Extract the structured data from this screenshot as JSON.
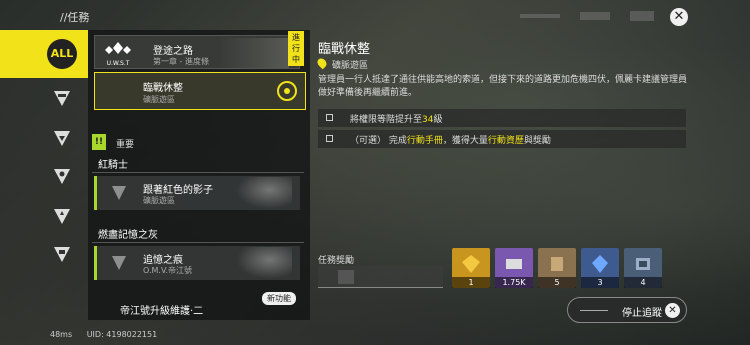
{
  "header": {
    "title": "//任務",
    "close_icon": "close-icon"
  },
  "rail": {
    "all_label": "ALL",
    "icons": [
      "category-icon-1",
      "category-icon-2",
      "category-icon-3",
      "category-icon-4",
      "category-icon-5"
    ]
  },
  "list": {
    "top_card": {
      "badge": "進行中",
      "logo_text": "U.W.S.T",
      "title": "登途之路",
      "subtitle": "第一章 - 進度條"
    },
    "active_card": {
      "title": "臨戰休整",
      "subtitle": "礦脈遊區"
    },
    "section_label": "重要",
    "groups": [
      {
        "title": "紅騎士",
        "item_title": "跟著紅色的影子",
        "item_subtitle": "礦脈遊區"
      },
      {
        "title": "燃盡記憶之灰",
        "item_title": "追憶之痕",
        "item_subtitle": "O.M.V.帝江號"
      },
      {
        "title": "帝江號升級維護·二",
        "new_tag": "新功能"
      }
    ]
  },
  "footer": {
    "ping": "48ms",
    "uid": "UID: 4198022151"
  },
  "detail": {
    "title": "臨戰休整",
    "location": "礦脈遊區",
    "description": "管理員一行人抵達了通往供能高地的索道，但接下來的道路更加危機四伏，佩麗卡建議管理員做好準備後再繼續前進。",
    "requirements": [
      {
        "prefix": "將權限等階提升至",
        "highlight": "34",
        "suffix": "級"
      },
      {
        "prefix": "（可選） 完成",
        "highlight": "行動手冊",
        "suffix": "，獲得大量",
        "highlight2": "行動資歷",
        "suffix2": "與獎勵"
      }
    ]
  },
  "rewards": {
    "label": "任務獎勵",
    "items": [
      {
        "amount": "1",
        "color": "#c8961e",
        "icon": "gold-crystal-icon"
      },
      {
        "amount": "1.75K",
        "color": "#7a58b0",
        "icon": "ticket-icon"
      },
      {
        "amount": "5",
        "color": "#8a7250",
        "icon": "material-icon"
      },
      {
        "amount": "3",
        "color": "#3e5a8e",
        "icon": "blue-crystal-icon"
      },
      {
        "amount": "4",
        "color": "#4a5e78",
        "icon": "device-icon"
      }
    ]
  },
  "stop_button": {
    "label": "停止追蹤"
  },
  "colors": {
    "accent": "#f2e21a",
    "important": "#a8d82c"
  }
}
